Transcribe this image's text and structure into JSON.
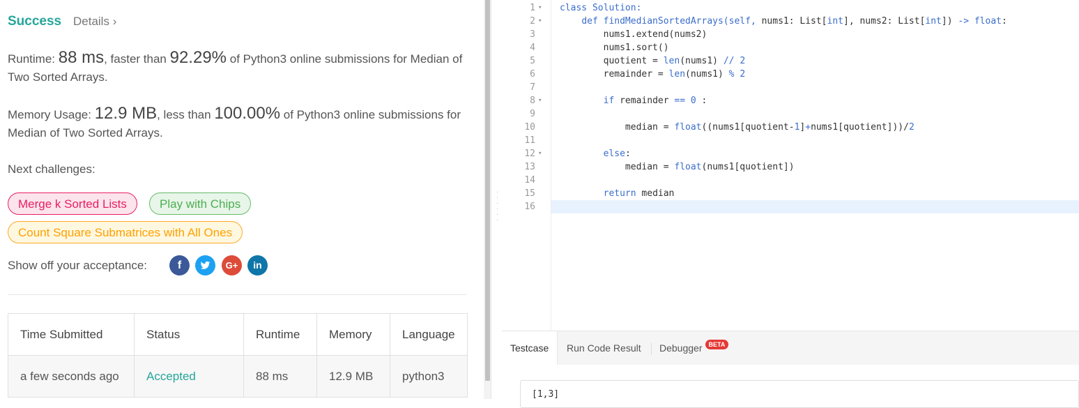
{
  "result": {
    "status": "Success",
    "details_label": "Details",
    "runtime_prefix": "Runtime: ",
    "runtime_value": "88 ms",
    "runtime_mid": ", faster than ",
    "runtime_percent": "92.29%",
    "runtime_suffix": " of Python3 online submissions for Median of Two Sorted Arrays.",
    "memory_prefix": "Memory Usage: ",
    "memory_value": "12.9 MB",
    "memory_mid": ", less than ",
    "memory_percent": "100.00%",
    "memory_suffix": " of Python3 online submissions for Median of Two Sorted Arrays."
  },
  "next": {
    "title": "Next challenges:",
    "items": [
      "Merge k Sorted Lists",
      "Play with Chips",
      "Count Square Submatrices with All Ones"
    ]
  },
  "share": {
    "label": "Show off your acceptance:",
    "icons": [
      {
        "name": "facebook-icon",
        "glyph": "f",
        "color": "#3b5998"
      },
      {
        "name": "twitter-icon",
        "glyph": "t",
        "color": "#1da1f2"
      },
      {
        "name": "google-plus-icon",
        "glyph": "G+",
        "color": "#dd4b39"
      },
      {
        "name": "linkedin-icon",
        "glyph": "in",
        "color": "#0e76a8"
      }
    ]
  },
  "table": {
    "headers": [
      "Time Submitted",
      "Status",
      "Runtime",
      "Memory",
      "Language"
    ],
    "row": [
      "a few seconds ago",
      "Accepted",
      "88 ms",
      "12.9 MB",
      "python3"
    ]
  },
  "editor": {
    "line_numbers": [
      "1",
      "2",
      "3",
      "4",
      "5",
      "6",
      "7",
      "8",
      "9",
      "10",
      "11",
      "12",
      "13",
      "14",
      "15",
      "16"
    ],
    "fold_markers": [
      "▾",
      "▾",
      "",
      "",
      "",
      "",
      "",
      "▾",
      "",
      "",
      "",
      "▾",
      "",
      "",
      "",
      ""
    ]
  },
  "bottom_tabs": {
    "testcase": "Testcase",
    "run_result": "Run Code Result",
    "debugger": "Debugger",
    "beta": "BETA",
    "test_input": "[1,3]"
  },
  "colors": {
    "accent": "#26a69a",
    "link": "#3a6dcc"
  }
}
